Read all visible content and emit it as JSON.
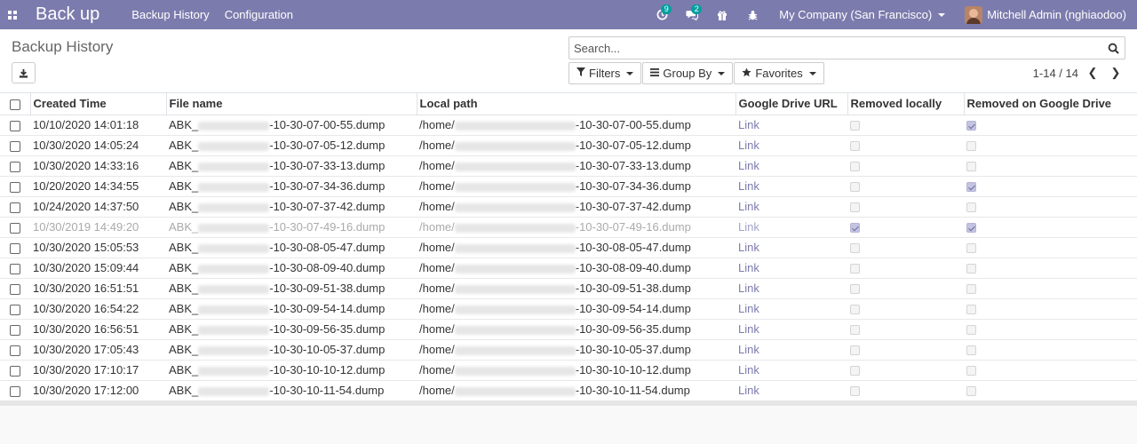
{
  "navbar": {
    "brand": "Back up",
    "menu": [
      "Backup History",
      "Configuration"
    ],
    "activity_count": "9",
    "messages_count": "2",
    "company": "My Company (San Francisco)",
    "user": "Mitchell Admin (nghiaodoo)"
  },
  "control_panel": {
    "title": "Backup History",
    "search_placeholder": "Search...",
    "filters_label": "Filters",
    "groupby_label": "Group By",
    "favorites_label": "Favorites",
    "pager": "1-14 / 14"
  },
  "table": {
    "headers": [
      "Created Time",
      "File name",
      "Local path",
      "Google Drive URL",
      "Removed locally",
      "Removed on Google Drive"
    ],
    "rows": [
      {
        "time": "10/10/2020 14:01:18",
        "file_prefix": "ABK_",
        "file_suffix": "-10-30-07-00-55.dump",
        "path_prefix": "/home/",
        "path_suffix": "-10-30-07-00-55.dump",
        "url": "Link",
        "removed_locally": false,
        "removed_gdrive": true,
        "muted": false
      },
      {
        "time": "10/30/2020 14:05:24",
        "file_prefix": "ABK_",
        "file_suffix": "-10-30-07-05-12.dump",
        "path_prefix": "/home/",
        "path_suffix": "-10-30-07-05-12.dump",
        "url": "Link",
        "removed_locally": false,
        "removed_gdrive": false,
        "muted": false
      },
      {
        "time": "10/30/2020 14:33:16",
        "file_prefix": "ABK_",
        "file_suffix": "-10-30-07-33-13.dump",
        "path_prefix": "/home/",
        "path_suffix": "-10-30-07-33-13.dump",
        "url": "Link",
        "removed_locally": false,
        "removed_gdrive": false,
        "muted": false
      },
      {
        "time": "10/20/2020 14:34:55",
        "file_prefix": "ABK_",
        "file_suffix": "-10-30-07-34-36.dump",
        "path_prefix": "/home/",
        "path_suffix": "-10-30-07-34-36.dump",
        "url": "Link",
        "removed_locally": false,
        "removed_gdrive": true,
        "muted": false
      },
      {
        "time": "10/24/2020 14:37:50",
        "file_prefix": "ABK_",
        "file_suffix": "-10-30-07-37-42.dump",
        "path_prefix": "/home/",
        "path_suffix": "-10-30-07-37-42.dump",
        "url": "Link",
        "removed_locally": false,
        "removed_gdrive": false,
        "muted": false
      },
      {
        "time": "10/30/2019 14:49:20",
        "file_prefix": "ABK_",
        "file_suffix": "-10-30-07-49-16.dump",
        "path_prefix": "/home/",
        "path_suffix": "-10-30-07-49-16.dump",
        "url": "Link",
        "removed_locally": true,
        "removed_gdrive": true,
        "muted": true
      },
      {
        "time": "10/30/2020 15:05:53",
        "file_prefix": "ABK_",
        "file_suffix": "-10-30-08-05-47.dump",
        "path_prefix": "/home/",
        "path_suffix": "-10-30-08-05-47.dump",
        "url": "Link",
        "removed_locally": false,
        "removed_gdrive": false,
        "muted": false
      },
      {
        "time": "10/30/2020 15:09:44",
        "file_prefix": "ABK_",
        "file_suffix": "-10-30-08-09-40.dump",
        "path_prefix": "/home/",
        "path_suffix": "-10-30-08-09-40.dump",
        "url": "Link",
        "removed_locally": false,
        "removed_gdrive": false,
        "muted": false
      },
      {
        "time": "10/30/2020 16:51:51",
        "file_prefix": "ABK_",
        "file_suffix": "-10-30-09-51-38.dump",
        "path_prefix": "/home/",
        "path_suffix": "-10-30-09-51-38.dump",
        "url": "Link",
        "removed_locally": false,
        "removed_gdrive": false,
        "muted": false
      },
      {
        "time": "10/30/2020 16:54:22",
        "file_prefix": "ABK_",
        "file_suffix": "-10-30-09-54-14.dump",
        "path_prefix": "/home/",
        "path_suffix": "-10-30-09-54-14.dump",
        "url": "Link",
        "removed_locally": false,
        "removed_gdrive": false,
        "muted": false
      },
      {
        "time": "10/30/2020 16:56:51",
        "file_prefix": "ABK_",
        "file_suffix": "-10-30-09-56-35.dump",
        "path_prefix": "/home/",
        "path_suffix": "-10-30-09-56-35.dump",
        "url": "Link",
        "removed_locally": false,
        "removed_gdrive": false,
        "muted": false
      },
      {
        "time": "10/30/2020 17:05:43",
        "file_prefix": "ABK_",
        "file_suffix": "-10-30-10-05-37.dump",
        "path_prefix": "/home/",
        "path_suffix": "-10-30-10-05-37.dump",
        "url": "Link",
        "removed_locally": false,
        "removed_gdrive": false,
        "muted": false
      },
      {
        "time": "10/30/2020 17:10:17",
        "file_prefix": "ABK_",
        "file_suffix": "-10-30-10-10-12.dump",
        "path_prefix": "/home/",
        "path_suffix": "-10-30-10-10-12.dump",
        "url": "Link",
        "removed_locally": false,
        "removed_gdrive": false,
        "muted": false
      },
      {
        "time": "10/30/2020 17:12:00",
        "file_prefix": "ABK_",
        "file_suffix": "-10-30-10-11-54.dump",
        "path_prefix": "/home/",
        "path_suffix": "-10-30-10-11-54.dump",
        "url": "Link",
        "removed_locally": false,
        "removed_gdrive": false,
        "muted": false
      }
    ]
  },
  "colors": {
    "navbar": "#7c7bad",
    "badge": "#00a09d",
    "link": "#7c7bad"
  }
}
